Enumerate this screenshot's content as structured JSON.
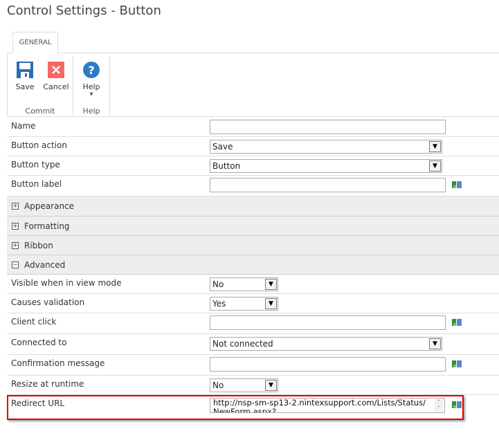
{
  "title": "Control Settings - Button",
  "ribbon": {
    "tab": "GENERAL",
    "groups": [
      {
        "label": "Commit"
      },
      {
        "label": "Help"
      }
    ],
    "save": "Save",
    "cancel": "Cancel",
    "help": "Help"
  },
  "colors": {
    "save": "#2a6fb0",
    "cancel": "#f36b63",
    "help": "#2d7dc4",
    "highlight": "#e00000"
  },
  "fields": {
    "name": {
      "label": "Name",
      "value": ""
    },
    "button_action": {
      "label": "Button action",
      "value": "Save"
    },
    "button_type": {
      "label": "Button type",
      "value": "Button"
    },
    "button_label": {
      "label": "Button label",
      "value": ""
    },
    "visible_view": {
      "label": "Visible when in view mode",
      "value": "No"
    },
    "causes_validation": {
      "label": "Causes validation",
      "value": "Yes"
    },
    "client_click": {
      "label": "Client click",
      "value": ""
    },
    "connected_to": {
      "label": "Connected to",
      "value": "Not connected"
    },
    "confirmation": {
      "label": "Confirmation message",
      "value": ""
    },
    "resize": {
      "label": "Resize at runtime",
      "value": "No"
    },
    "redirect": {
      "label": "Redirect URL",
      "value": "http://nsp-sm-sp13-2.nintexsupport.com/Lists/Status/NewForm.aspx?"
    }
  },
  "sections": {
    "appearance": "Appearance",
    "formatting": "Formatting",
    "ribbon": "Ribbon",
    "advanced": "Advanced"
  }
}
